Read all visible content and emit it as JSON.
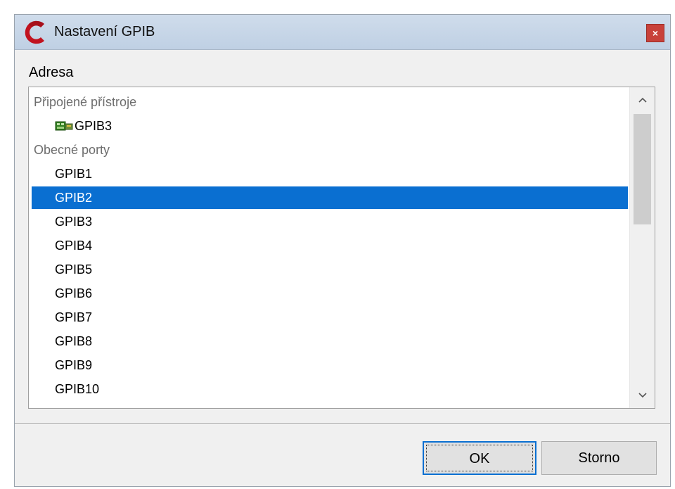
{
  "window": {
    "title": "Nastavení GPIB",
    "close_glyph": "×"
  },
  "address_label": "Adresa",
  "list": {
    "groups": [
      {
        "header": "Připojené přístroje",
        "items": [
          {
            "label": "GPIB3",
            "icon": "instrument-icon",
            "selected": false
          }
        ]
      },
      {
        "header": "Obecné porty",
        "items": [
          {
            "label": "GPIB1",
            "selected": false
          },
          {
            "label": "GPIB2",
            "selected": true
          },
          {
            "label": "GPIB3",
            "selected": false
          },
          {
            "label": "GPIB4",
            "selected": false
          },
          {
            "label": "GPIB5",
            "selected": false
          },
          {
            "label": "GPIB6",
            "selected": false
          },
          {
            "label": "GPIB7",
            "selected": false
          },
          {
            "label": "GPIB8",
            "selected": false
          },
          {
            "label": "GPIB9",
            "selected": false
          },
          {
            "label": "GPIB10",
            "selected": false
          }
        ]
      }
    ],
    "scroll_up_glyph": "⌃",
    "scroll_down_glyph": "⌄"
  },
  "buttons": {
    "ok_label": "OK",
    "cancel_label": "Storno"
  },
  "colors": {
    "selection": "#0a6fd1",
    "close_button": "#c8413a",
    "app_logo": "#c1121f"
  }
}
